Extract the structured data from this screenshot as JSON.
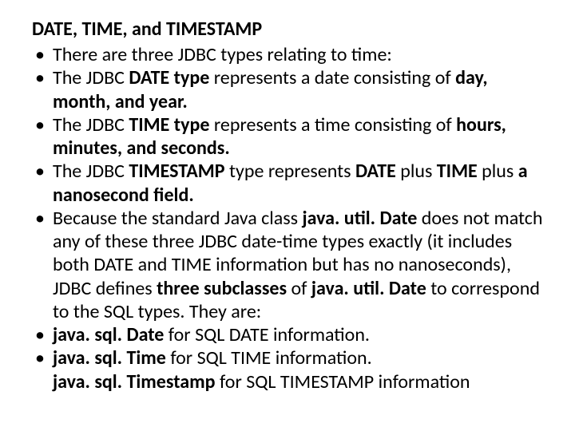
{
  "heading": "DATE, TIME, and TIMESTAMP",
  "bullets": {
    "b1": "There are three JDBC types relating to time:",
    "b2": {
      "t1": "The JDBC",
      "t2": "DATE type",
      "t3": "represents a date consisting of",
      "t4": "day, month, and year."
    },
    "b3": {
      "t1": "The JDBC",
      "t2": "TIME type",
      "t3": "represents a time consisting of",
      "t4": "hours, minutes, and seconds."
    },
    "b4": {
      "t1": "The JDBC",
      "t2": "TIMESTAMP",
      "t3": "type represents",
      "t4": "DATE",
      "t5": "plus",
      "t6": "TIME",
      "t7": "plus",
      "t8": "a nanosecond field."
    },
    "b5": {
      "t1": "Because the standard Java class",
      "t2": "java. util. Date",
      "t3": "does not match any of these three JDBC date-time types exactly (it includes both DATE and TIME information but has no nanoseconds), JDBC defines",
      "t4": "three subclasses",
      "t5": "of",
      "t6": "java. util. Date",
      "t7": "to correspond to the SQL types. They are:"
    },
    "b6": {
      "t1": "java. sql. Date",
      "t2": "for SQL DATE information."
    },
    "b7": {
      "t1": "java. sql. Time",
      "t2": "for SQL TIME information."
    },
    "cont": {
      "t1": "java. sql. Timestamp",
      "t2": "for SQL TIMESTAMP information"
    }
  }
}
